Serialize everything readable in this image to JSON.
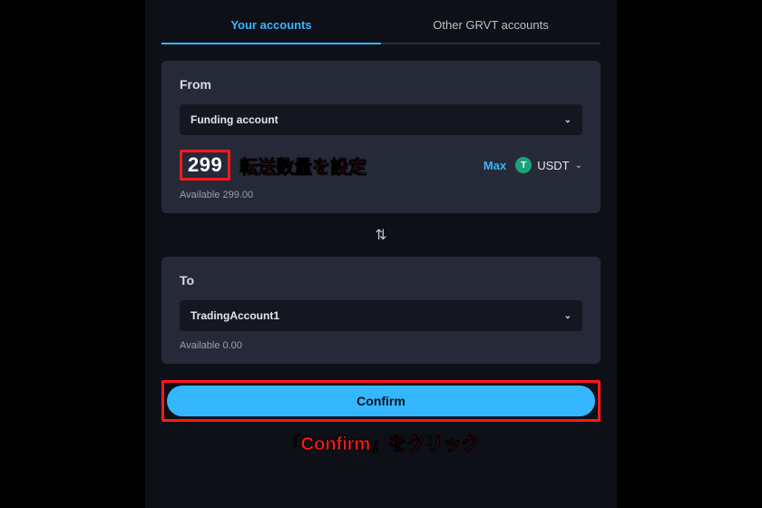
{
  "tabs": {
    "your_accounts": "Your accounts",
    "other_accounts": "Other GRVT accounts"
  },
  "from": {
    "label": "From",
    "account": "Funding account",
    "amount": "299",
    "annotation": "転送数量を設定",
    "max": "Max",
    "currency": "USDT",
    "currency_icon_letter": "T",
    "available": "Available 299.00"
  },
  "to": {
    "label": "To",
    "account": "TradingAccount1",
    "available": "Available 0.00"
  },
  "confirm": {
    "label": "Confirm",
    "annotation": "「Confirm」をクリック"
  }
}
